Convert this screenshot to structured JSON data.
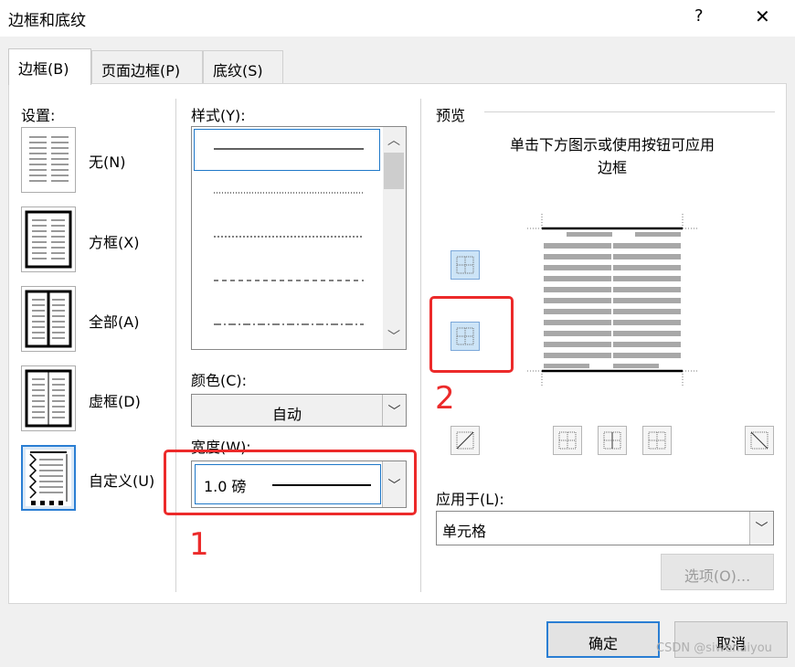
{
  "window": {
    "title": "边框和底纹",
    "help": "?",
    "close": "✕"
  },
  "tabs": [
    {
      "label": "边框(B)"
    },
    {
      "label": "页面边框(P)"
    },
    {
      "label": "底纹(S)"
    }
  ],
  "settings": {
    "label": "设置:",
    "items": [
      {
        "label": "无(N)"
      },
      {
        "label": "方框(X)"
      },
      {
        "label": "全部(A)"
      },
      {
        "label": "虚框(D)"
      },
      {
        "label": "自定义(U)"
      }
    ],
    "selected": "自定义(U)"
  },
  "style": {
    "label": "样式(Y):",
    "selected": "solid"
  },
  "color": {
    "label": "颜色(C):",
    "value": "自动"
  },
  "width": {
    "label": "宽度(W):",
    "value": "1.0 磅"
  },
  "preview": {
    "label": "预览",
    "hint_line1": "单击下方图示或使用按钮可应用",
    "hint_line2": "边框"
  },
  "apply_to": {
    "label": "应用于(L):",
    "value": "单元格"
  },
  "options_button": "选项(O)...",
  "ok_button": "确定",
  "cancel_button": "取消",
  "annotations": {
    "num1": "1",
    "num2": "2",
    "color": "#ec2a2a"
  },
  "watermark": "CSDN @siwenaiyou"
}
